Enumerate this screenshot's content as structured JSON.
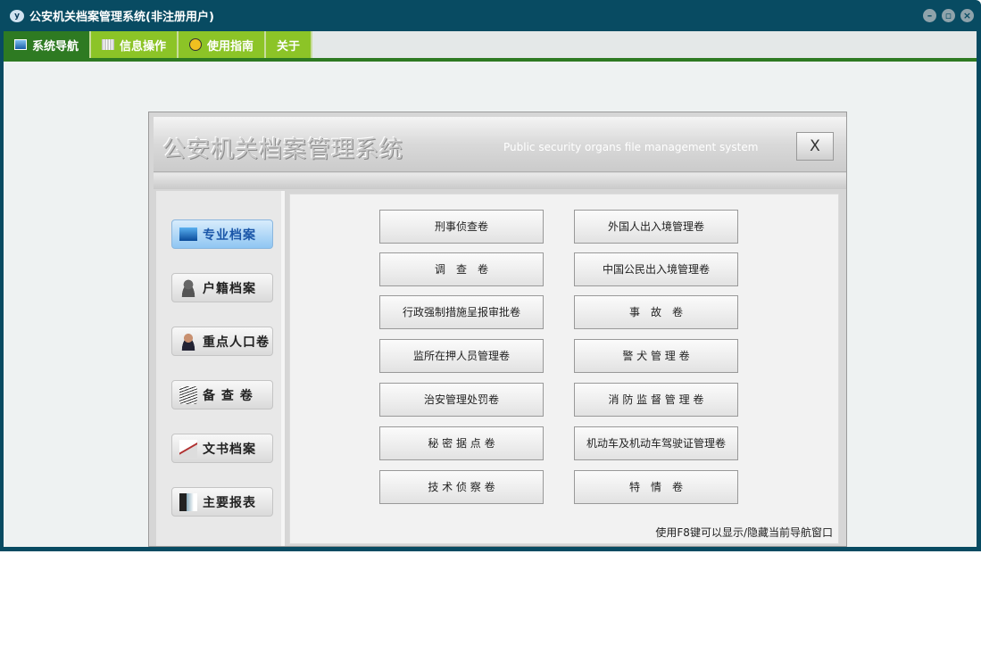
{
  "window": {
    "title": "公安机关档案管理系统(非注册用户)",
    "controls": [
      "minimize",
      "restore",
      "close"
    ]
  },
  "tabs": [
    {
      "label": "系统导航",
      "icon": "monitor-icon",
      "active": true
    },
    {
      "label": "信息操作",
      "icon": "grid-icon"
    },
    {
      "label": "使用指南",
      "icon": "help-icon"
    },
    {
      "label": "关于"
    }
  ],
  "dialog": {
    "title": "公安机关档案管理系统",
    "subtitle": "Public security organs file management system",
    "close": "X"
  },
  "sidebar": [
    {
      "label": "专业档案",
      "icon": "monitor-icon",
      "active": true
    },
    {
      "label": "户籍档案",
      "icon": "person-icon"
    },
    {
      "label": "重点人口卷",
      "icon": "officer-icon"
    },
    {
      "label": "备 查 卷",
      "icon": "magnifier-document-icon"
    },
    {
      "label": "文书档案",
      "icon": "scroll-icon"
    },
    {
      "label": "主要报表",
      "icon": "report-icon"
    }
  ],
  "buttons_left": [
    "刑事侦查卷",
    "调　查　卷",
    "行政强制措施呈报审批卷",
    "监所在押人员管理卷",
    "治安管理处罚卷",
    "秘 密 据 点 卷",
    "技 术 侦 察 卷"
  ],
  "buttons_right": [
    "外国人出入境管理卷",
    "中国公民出入境管理卷",
    "事　故　卷",
    "警 犬 管 理 卷",
    "消 防 监 督 管 理 卷",
    "机动车及机动车驾驶证管理卷",
    "特　情　卷"
  ],
  "hint": "使用F8键可以显示/隐藏当前导航窗口"
}
